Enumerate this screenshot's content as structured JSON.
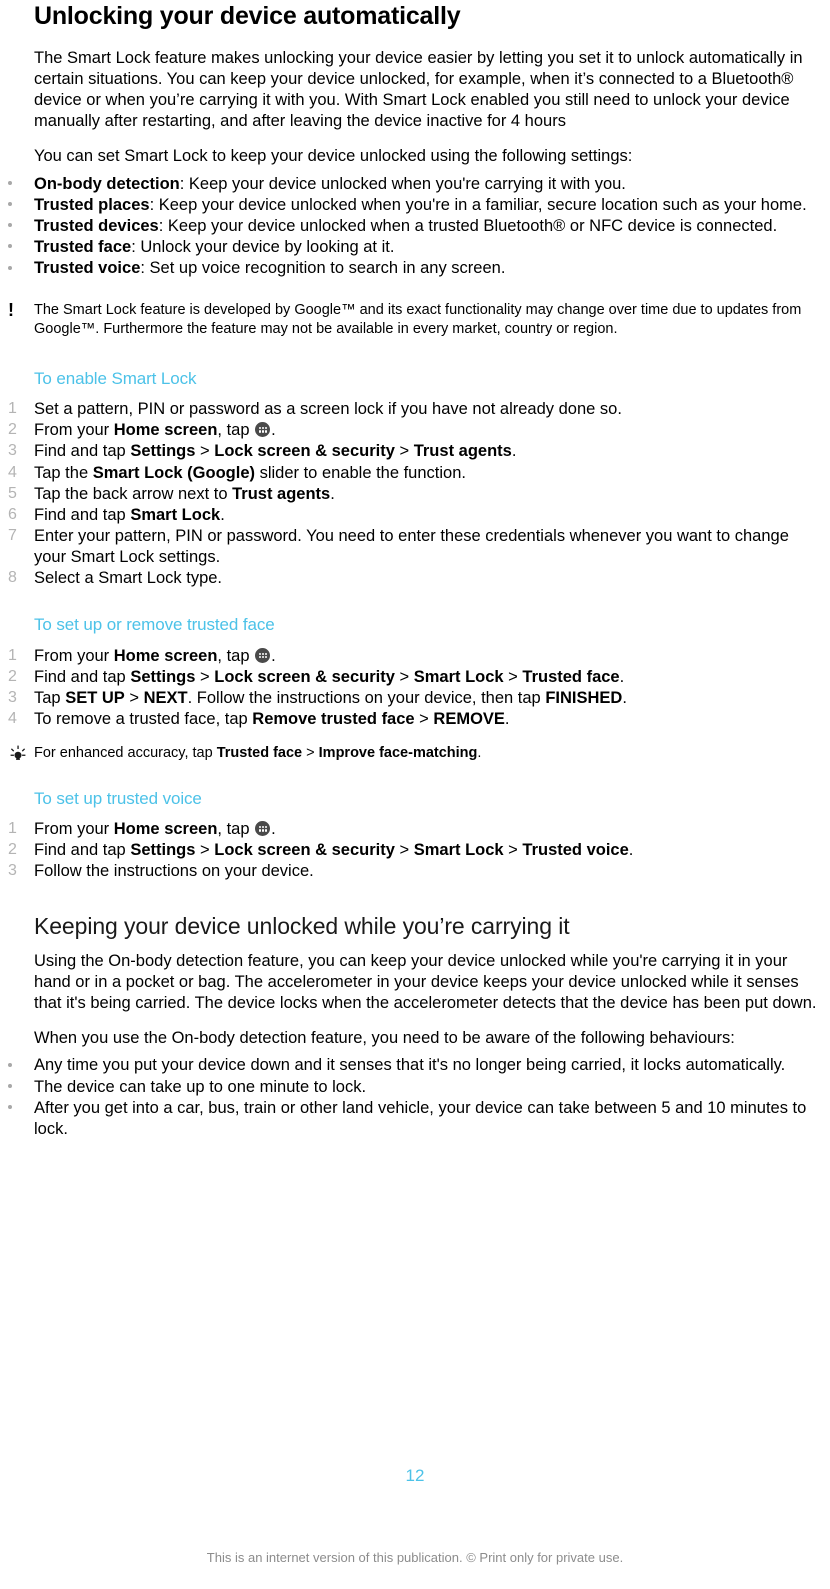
{
  "document": {
    "title": "Unlocking your device automatically",
    "page_number": "12",
    "footer": "This is an internet version of this publication. © Print only for private use.",
    "accent_color": "#4cc2e8",
    "body_color": "#000000",
    "marker_color": "#b4b4b4"
  },
  "intro": {
    "paragraph1": "The Smart Lock feature makes unlocking your device easier by letting you set it to unlock automatically in certain situations. You can keep your device unlocked, for example, when it’s connected to a Bluetooth® device or when you’re carrying it with you. With Smart Lock enabled you still need to unlock your device manually after restarting, and after leaving the device inactive for 4 hours",
    "paragraph2": "You can set Smart Lock to keep your device unlocked using the following settings:"
  },
  "settings_bullets": [
    {
      "term": "On-body detection",
      "rest": ": Keep your device unlocked when you're carrying it with you."
    },
    {
      "term": "Trusted places",
      "rest": ": Keep your device unlocked when you're in a familiar, secure location such as your home."
    },
    {
      "term": "Trusted devices",
      "rest": ": Keep your device unlocked when a trusted Bluetooth® or NFC device is connected."
    },
    {
      "term": "Trusted face",
      "rest": ": Unlock your device by looking at it."
    },
    {
      "term": "Trusted voice",
      "rest": ": Set up voice recognition to search in any screen."
    }
  ],
  "note_google": {
    "icon": "exclamation-icon",
    "text": "The Smart Lock feature is developed by Google™ and its exact functionality may change over time due to updates from Google™. Furthermore the feature may not be available in every market, country or region."
  },
  "proc_enable": {
    "title": "To enable Smart Lock",
    "steps": [
      {
        "num": "1",
        "parts": [
          {
            "t": "Set a pattern, PIN or password as a screen lock if you have not already done so.",
            "b": false
          }
        ]
      },
      {
        "num": "2",
        "parts": [
          {
            "t": "From your ",
            "b": false
          },
          {
            "t": "Home screen",
            "b": true
          },
          {
            "t": ", tap ",
            "b": false
          },
          {
            "icon": "app-drawer-icon"
          },
          {
            "t": ".",
            "b": false
          }
        ]
      },
      {
        "num": "3",
        "parts": [
          {
            "t": "Find and tap ",
            "b": false
          },
          {
            "t": "Settings",
            "b": true
          },
          {
            "t": " > ",
            "b": false
          },
          {
            "t": "Lock screen & security",
            "b": true
          },
          {
            "t": " > ",
            "b": false
          },
          {
            "t": "Trust agents",
            "b": true
          },
          {
            "t": ".",
            "b": false
          }
        ]
      },
      {
        "num": "4",
        "parts": [
          {
            "t": "Tap the ",
            "b": false
          },
          {
            "t": "Smart Lock (Google)",
            "b": true
          },
          {
            "t": " slider to enable the function.",
            "b": false
          }
        ]
      },
      {
        "num": "5",
        "parts": [
          {
            "t": "Tap the back arrow next to ",
            "b": false
          },
          {
            "t": "Trust agents",
            "b": true
          },
          {
            "t": ".",
            "b": false
          }
        ]
      },
      {
        "num": "6",
        "parts": [
          {
            "t": "Find and tap ",
            "b": false
          },
          {
            "t": "Smart Lock",
            "b": true
          },
          {
            "t": ".",
            "b": false
          }
        ]
      },
      {
        "num": "7",
        "parts": [
          {
            "t": "Enter your pattern, PIN or password. You need to enter these credentials whenever you want to change your Smart Lock settings.",
            "b": false
          }
        ]
      },
      {
        "num": "8",
        "parts": [
          {
            "t": "Select a Smart Lock type.",
            "b": false
          }
        ]
      }
    ]
  },
  "proc_face": {
    "title": "To set up or remove trusted face",
    "steps": [
      {
        "num": "1",
        "parts": [
          {
            "t": "From your ",
            "b": false
          },
          {
            "t": "Home screen",
            "b": true
          },
          {
            "t": ", tap ",
            "b": false
          },
          {
            "icon": "app-drawer-icon"
          },
          {
            "t": ".",
            "b": false
          }
        ]
      },
      {
        "num": "2",
        "parts": [
          {
            "t": "Find and tap ",
            "b": false
          },
          {
            "t": "Settings",
            "b": true
          },
          {
            "t": " > ",
            "b": false
          },
          {
            "t": "Lock screen & security",
            "b": true
          },
          {
            "t": " > ",
            "b": false
          },
          {
            "t": "Smart Lock",
            "b": true
          },
          {
            "t": " > ",
            "b": false
          },
          {
            "t": "Trusted face",
            "b": true
          },
          {
            "t": ".",
            "b": false
          }
        ]
      },
      {
        "num": "3",
        "parts": [
          {
            "t": "Tap ",
            "b": false
          },
          {
            "t": "SET UP",
            "b": true
          },
          {
            "t": " > ",
            "b": false
          },
          {
            "t": "NEXT",
            "b": true
          },
          {
            "t": ". Follow the instructions on your device, then tap ",
            "b": false
          },
          {
            "t": "FINISHED",
            "b": true
          },
          {
            "t": ".",
            "b": false
          }
        ]
      },
      {
        "num": "4",
        "parts": [
          {
            "t": "To remove a trusted face, tap ",
            "b": false
          },
          {
            "t": "Remove trusted face",
            "b": true
          },
          {
            "t": " > ",
            "b": false
          },
          {
            "t": "REMOVE",
            "b": true
          },
          {
            "t": ".",
            "b": false
          }
        ]
      }
    ],
    "tip": {
      "icon": "lightbulb-icon",
      "parts": [
        {
          "t": "For enhanced accuracy, tap ",
          "b": false
        },
        {
          "t": "Trusted face",
          "b": true
        },
        {
          "t": " > ",
          "b": false
        },
        {
          "t": "Improve face-matching",
          "b": true
        },
        {
          "t": ".",
          "b": false
        }
      ]
    }
  },
  "proc_voice": {
    "title": "To set up trusted voice",
    "steps": [
      {
        "num": "1",
        "parts": [
          {
            "t": "From your ",
            "b": false
          },
          {
            "t": "Home screen",
            "b": true
          },
          {
            "t": ", tap ",
            "b": false
          },
          {
            "icon": "app-drawer-icon"
          },
          {
            "t": ".",
            "b": false
          }
        ]
      },
      {
        "num": "2",
        "parts": [
          {
            "t": "Find and tap ",
            "b": false
          },
          {
            "t": "Settings",
            "b": true
          },
          {
            "t": " > ",
            "b": false
          },
          {
            "t": "Lock screen & security",
            "b": true
          },
          {
            "t": " > ",
            "b": false
          },
          {
            "t": "Smart Lock",
            "b": true
          },
          {
            "t": " > ",
            "b": false
          },
          {
            "t": "Trusted voice",
            "b": true
          },
          {
            "t": ".",
            "b": false
          }
        ]
      },
      {
        "num": "3",
        "parts": [
          {
            "t": "Follow the instructions on your device.",
            "b": false
          }
        ]
      }
    ]
  },
  "section_onbody": {
    "title": "Keeping your device unlocked while you’re carrying it",
    "paragraph1": "Using the On-body detection feature, you can keep your device unlocked while you're carrying it in your hand or in a pocket or bag. The accelerometer in your device keeps your device unlocked while it senses that it's being carried. The device locks when the accelerometer detects that the device has been put down.",
    "paragraph2": "When you use the On-body detection feature, you need to be aware of the following behaviours:",
    "bullets": [
      "Any time you put your device down and it senses that it's no longer being carried, it locks automatically.",
      "The device can take up to one minute to lock.",
      "After you get into a car, bus, train or other land vehicle, your device can take between 5 and 10 minutes to lock."
    ]
  }
}
